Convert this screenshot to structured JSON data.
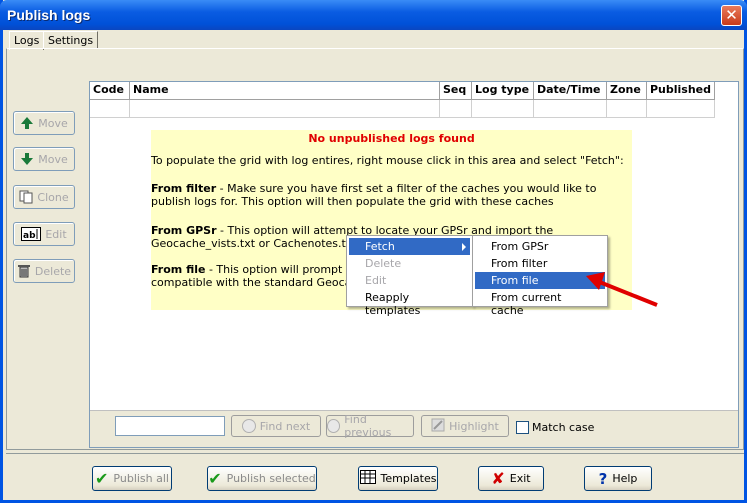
{
  "window": {
    "title": "Publish logs"
  },
  "tabs": [
    {
      "label": "Logs"
    },
    {
      "label": "Settings"
    }
  ],
  "side_buttons": {
    "move_up": "Move",
    "move_down": "Move",
    "clone": "Clone",
    "edit": "Edit",
    "delete": "Delete"
  },
  "grid": {
    "columns": [
      "Code",
      "Name",
      "Seq",
      "Log type",
      "Date/Time",
      "Zone",
      "Published"
    ]
  },
  "info": {
    "title": "No unpublished logs found",
    "intro": "To populate the grid with log entires, right mouse click in this area and select \"Fetch\":",
    "filter_head": "From filter",
    "filter_text": " - Make sure you have first set a filter of the caches you would like to publish logs for. This option will then populate the grid with these caches",
    "gpsr_head": "From GPSr",
    "gpsr_text": " - This option will attempt to locate your GPSr and import the Geocache_vists.txt or Cachenotes.txt file",
    "file_head": "From file",
    "file_text_1": " - This option will prompt you fo",
    "file_text_2": "compatible with the standard Geocache_"
  },
  "context_menu": {
    "items": [
      "Fetch",
      "Delete",
      "Edit",
      "Reapply templates"
    ]
  },
  "sub_menu": {
    "items": [
      "From GPSr",
      "From filter",
      "From file",
      "From current cache"
    ]
  },
  "footer": {
    "find_next": "Find next",
    "find_previous": "Find previous",
    "highlight": "Highlight",
    "match_case": "Match case"
  },
  "bottom": {
    "publish_all": "Publish all",
    "publish_selected": "Publish selected",
    "templates": "Templates",
    "exit": "Exit",
    "help": "Help"
  },
  "colors": {
    "title_bar": "#0a5ce2",
    "info_bg": "#ffffc6",
    "info_title": "#e00000",
    "menu_highlight": "#316ac5",
    "arrow": "#e00000"
  }
}
